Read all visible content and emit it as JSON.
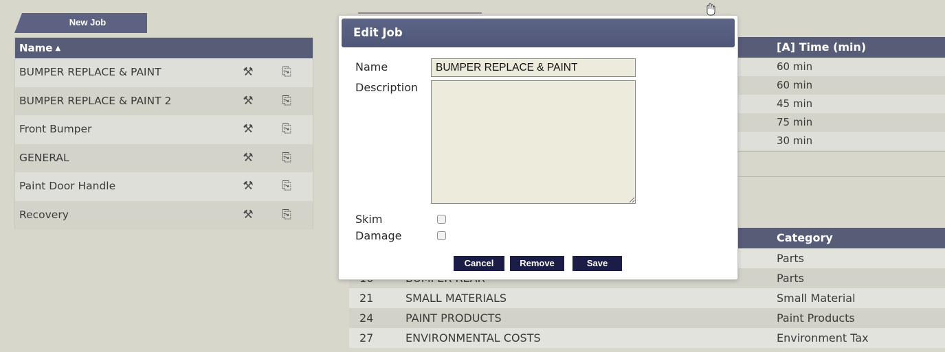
{
  "toolbar": {
    "new_job_label": "New Job"
  },
  "job_list": {
    "header": "Name",
    "sort_indicator": "▲",
    "rows": [
      {
        "name": "BUMPER REPLACE & PAINT"
      },
      {
        "name": "BUMPER REPLACE & PAINT 2"
      },
      {
        "name": "Front Bumper"
      },
      {
        "name": "GENERAL"
      },
      {
        "name": "Paint Door Handle"
      },
      {
        "name": "Recovery"
      }
    ],
    "icons": {
      "edit": "tools-icon",
      "copy": "copy-icon"
    }
  },
  "background_table": {
    "time_header": "[A] Time (min)",
    "times": [
      "60 min",
      "60 min",
      "45 min",
      "75 min",
      "30 min"
    ],
    "category_header": "Category",
    "items": [
      {
        "code": "",
        "description": "",
        "category": "Parts"
      },
      {
        "code": "16",
        "description": "BUMPER REAR",
        "category": "Parts"
      },
      {
        "code": "21",
        "description": "SMALL MATERIALS",
        "category": "Small Material"
      },
      {
        "code": "24",
        "description": "PAINT PRODUCTS",
        "category": "Paint Products"
      },
      {
        "code": "27",
        "description": "ENVIRONMENTAL COSTS",
        "category": "Environment Tax"
      }
    ]
  },
  "edit_job_dialog": {
    "title": "Edit Job",
    "name_label": "Name",
    "name_value": "BUMPER REPLACE & PAINT",
    "description_label": "Description",
    "description_value": "",
    "skim_label": "Skim",
    "skim_checked": false,
    "damage_label": "Damage",
    "damage_checked": false,
    "cancel_label": "Cancel",
    "remove_label": "Remove",
    "save_label": "Save"
  },
  "colors": {
    "header_bg": "#575c77",
    "dialog_title_bg": "#545b7c",
    "button_bg": "#1c1d47",
    "input_bg": "#edecdc",
    "page_bg": "#d8d7cc"
  }
}
